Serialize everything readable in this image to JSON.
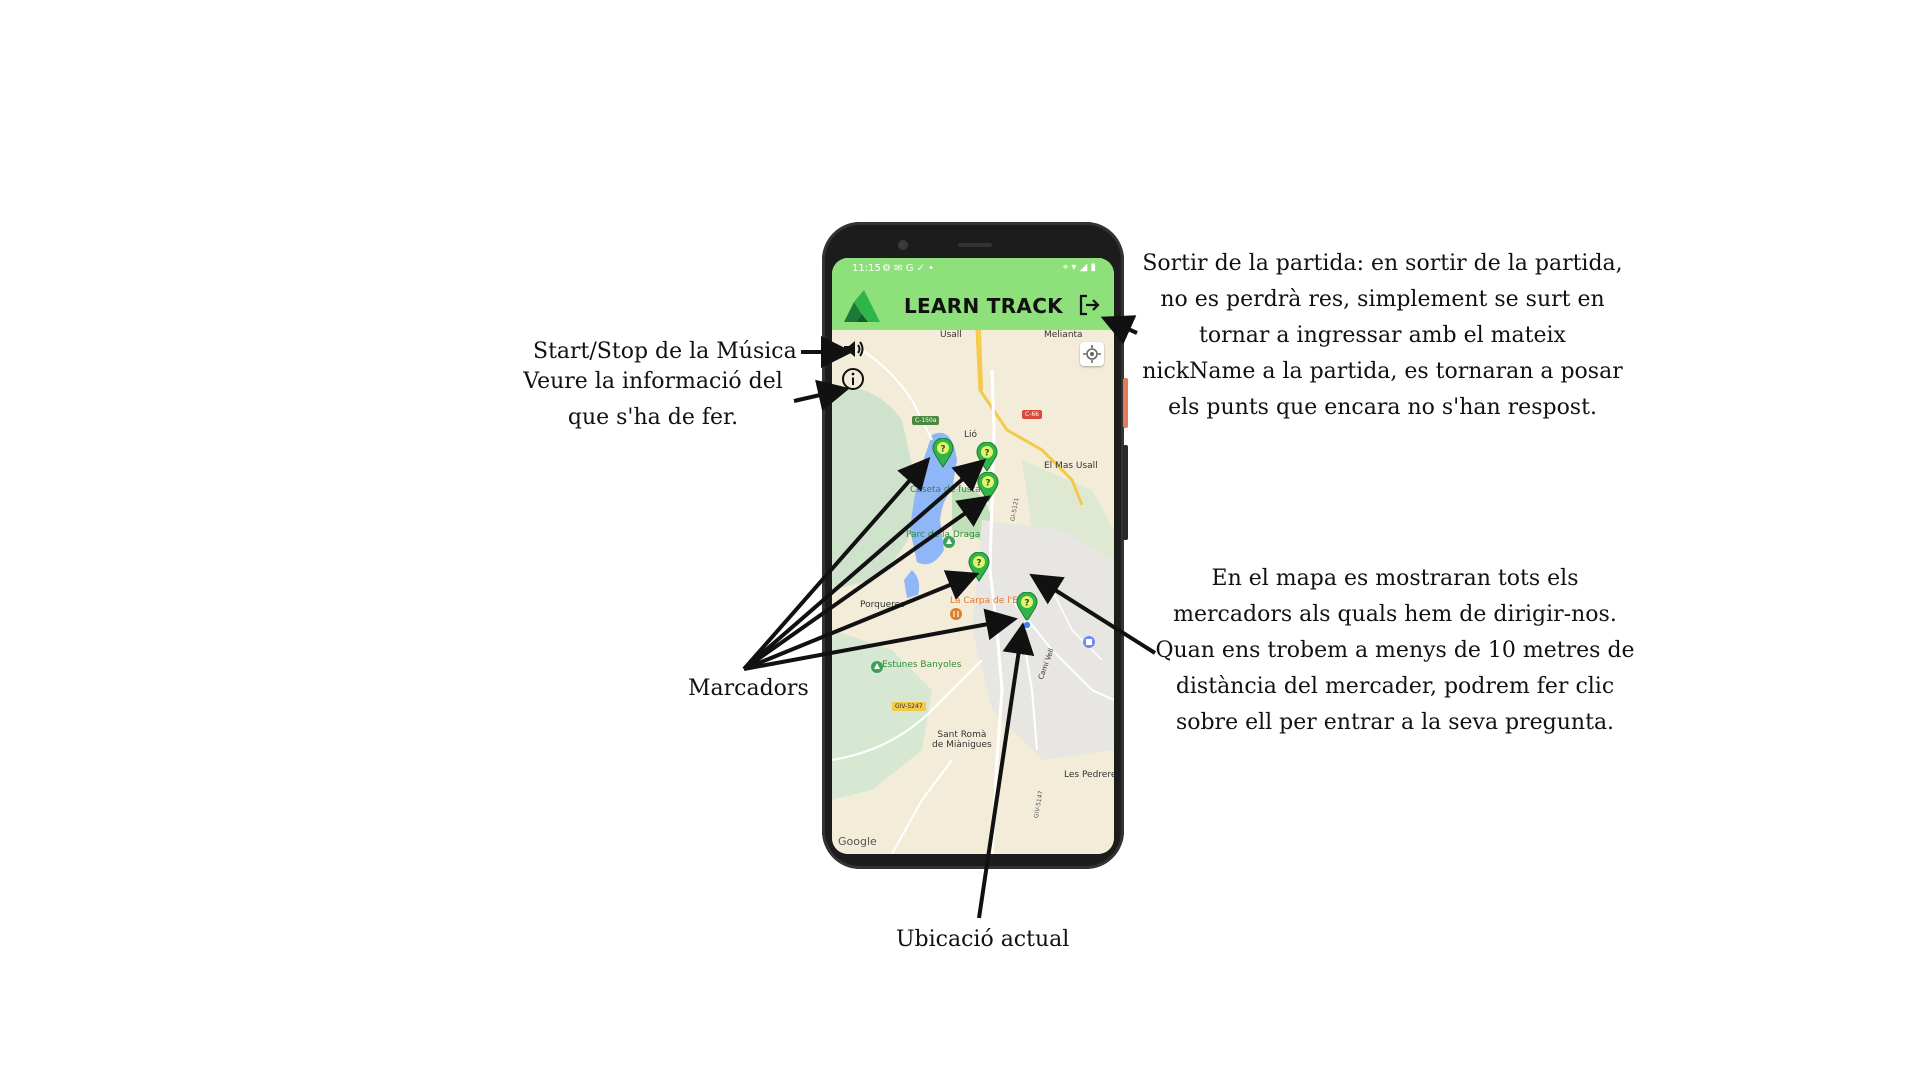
{
  "phone": {
    "status_time": "11:15",
    "status_left_icons": "⚙ ✉ G ✓ •",
    "status_right_icons": "⌖ ▾ ◢ ▮",
    "app_title": "LEARN TRACK"
  },
  "map": {
    "labels": {
      "usall": "Usall",
      "melianta": "Melianta",
      "lio": "Lió",
      "el_mas_usall": "El Mas Usall",
      "caseta": "Caseta de fusta",
      "parc": "Parc de la Draga",
      "porqueres": "Porqueres",
      "carpa": "La Carpa de l'E",
      "estunes": "Estunes Banyoles",
      "sant_roma": "Sant Romà\nde Miànigues",
      "les_pedreres": "Les Pedreres",
      "cami": "Camí Vell"
    },
    "roads": {
      "c150a": "C-150a",
      "c66": "C-66",
      "gi5247": "GIV-5247",
      "gi5121": "GI-5121",
      "gi5147": "GIV-5147"
    },
    "google": "Google"
  },
  "annotations": {
    "music": "Start/Stop de la Música",
    "info_line1": "Veure la informació del",
    "info_line2": "que s'ha de fer.",
    "exit": "Sortir de la partida: en sortir de la partida, no es perdrà res, simplement se surt en tornar a ingressar amb el mateix nickName a la partida, es tornaran a posar els punts que encara no s'han respost.",
    "markers_help": "En el mapa es mostraran tots els mercadors als quals hem de dirigir-nos. Quan ens trobem a menys de 10 metres de distància del mercader, podrem fer clic sobre ell per entrar a la seva pregunta.",
    "marcadors": "Marcadors",
    "ubicacio": "Ubicació actual"
  },
  "colors": {
    "appbar": "#8ee07a",
    "marker": "#2fb54a",
    "lake": "#8fb6f7",
    "park": "#cfe8c9"
  }
}
